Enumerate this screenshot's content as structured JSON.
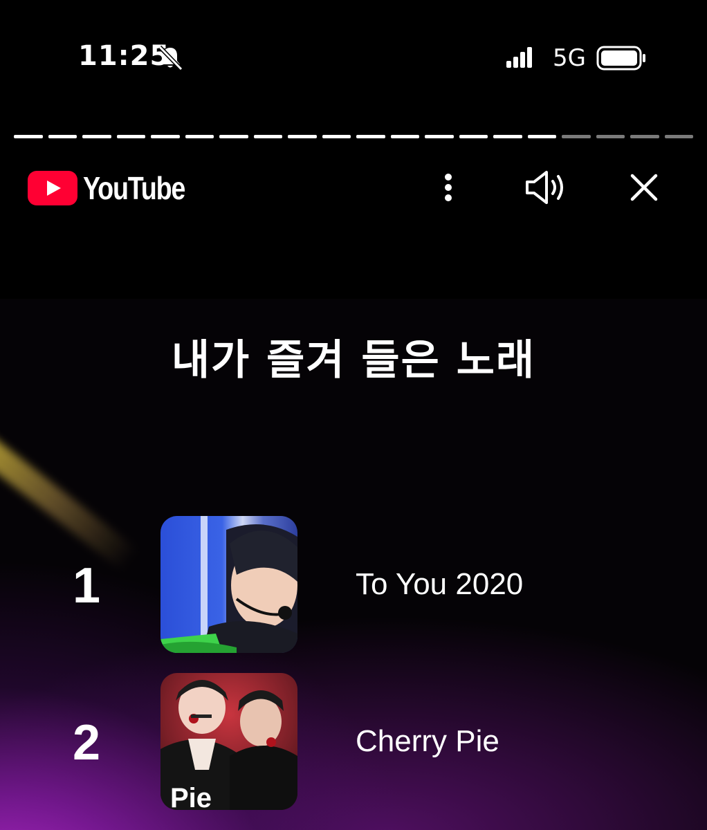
{
  "status_bar": {
    "time": "11:25",
    "network": "5G",
    "icons": [
      "bell-muted-icon",
      "signal-icon",
      "battery-icon"
    ]
  },
  "story_progress": {
    "segments_total": 20,
    "segments_done": 16
  },
  "header": {
    "logo_text": "YouTube",
    "brand_color": "#FF0033",
    "icons": [
      "more-vert-icon",
      "volume-icon",
      "close-icon"
    ]
  },
  "recap": {
    "title": "내가 즐겨 들은 노래",
    "songs": [
      {
        "rank": "1",
        "title": "To You 2020"
      },
      {
        "rank": "2",
        "title": "Cherry Pie",
        "thumb_caption": "Pie"
      }
    ]
  },
  "colors": {
    "background": "#000000",
    "accent_purple": "#C42FE0",
    "accent_yellow": "#E6CD3C"
  }
}
